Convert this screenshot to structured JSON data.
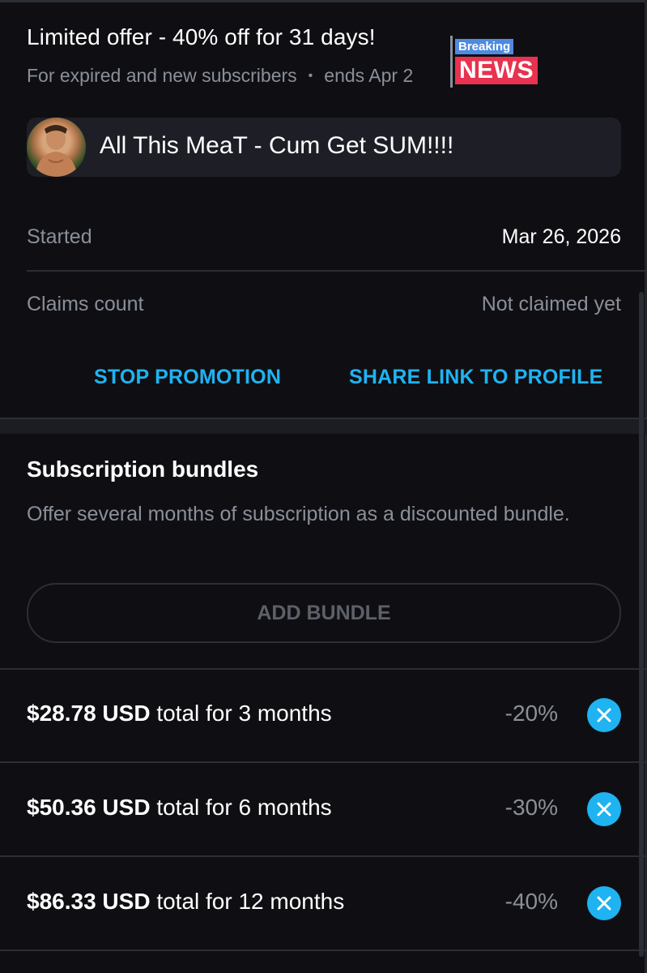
{
  "offer": {
    "title": "Limited offer - 40% off for 31 days!",
    "audience": "For expired and new subscribers",
    "separator": "•",
    "ends": "ends Apr 2"
  },
  "badge": {
    "top": "Breaking",
    "bottom": "NEWS"
  },
  "profile": {
    "name": "All This MeaT - Cum Get SUM!!!!"
  },
  "details": [
    {
      "label": "Started",
      "value": "Mar 26, 2026"
    },
    {
      "label": "Claims count",
      "value": "Not claimed yet"
    }
  ],
  "actions": {
    "stop": "STOP PROMOTION",
    "share": "SHARE LINK TO PROFILE"
  },
  "bundles": {
    "title": "Subscription bundles",
    "description": "Offer several months of subscription as a discounted bundle.",
    "add_label": "ADD BUNDLE",
    "items": [
      {
        "price": "$28.78 USD",
        "suffix": " total for 3 months",
        "discount": "-20%"
      },
      {
        "price": "$50.36 USD",
        "suffix": " total for 6 months",
        "discount": "-30%"
      },
      {
        "price": "$86.33 USD",
        "suffix": " total for 12 months",
        "discount": "-40%"
      }
    ]
  },
  "colors": {
    "accent": "#1fb3f2",
    "background": "#0f0f13",
    "muted": "#8a8f99",
    "badge_blue": "#4e8be0",
    "badge_red": "#e8324f"
  }
}
